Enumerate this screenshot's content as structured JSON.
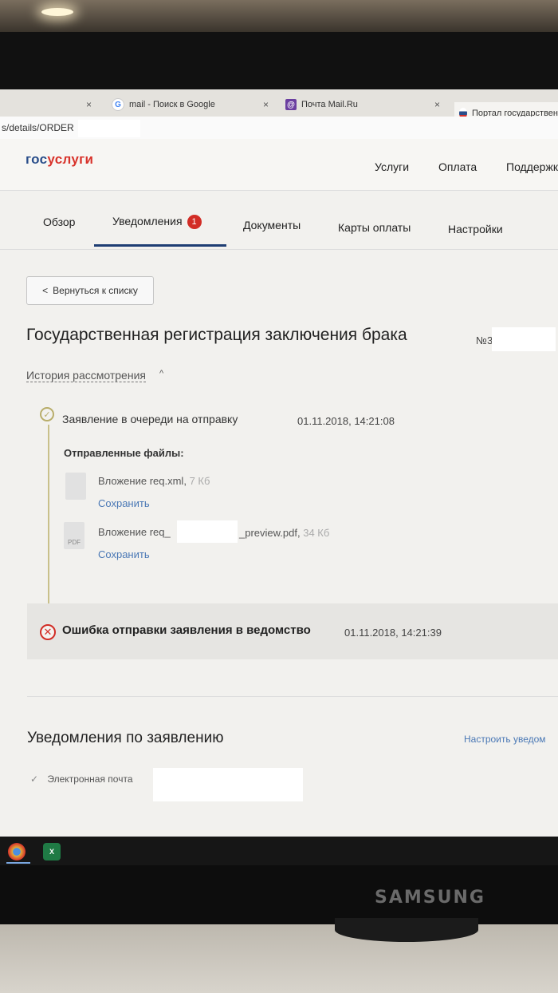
{
  "browser": {
    "tabs": [
      {
        "label": "",
        "favicon": "blank-icon"
      },
      {
        "label": "mail - Поиск в Google",
        "favicon": "google-icon"
      },
      {
        "label": "Почта Mail.Ru",
        "favicon": "mailru-icon"
      },
      {
        "label": "Портал государствен",
        "favicon": "gosuslugi-icon"
      }
    ],
    "close_glyph": "×",
    "address": "s/details/ORDER"
  },
  "header": {
    "logo_part1": "гос",
    "logo_part2": "услуги",
    "nav": [
      "Услуги",
      "Оплата",
      "Поддержк"
    ]
  },
  "subnav": {
    "tabs": [
      "Обзор",
      "Уведомления",
      "Документы",
      "Карты оплаты",
      "Настройки"
    ],
    "badge": "1"
  },
  "main": {
    "back_button": "Вернуться к списку",
    "back_glyph": "<",
    "title": "Государственная регистрация заключения брака",
    "number_prefix": "№3",
    "history_link": "История рассмотрения",
    "history_chevron": "^",
    "event1": {
      "title": "Заявление в очереди на отправку",
      "date": "01.11.2018, 14:21:08",
      "files_header": "Отправленные файлы:",
      "files": [
        {
          "name_start": "Вложение req.xml",
          "name_end": "",
          "size": "7 Кб",
          "icon_label": "",
          "save": "Сохранить"
        },
        {
          "name_start": "Вложение req_",
          "name_end": "_preview.pdf",
          "size": "34 Кб",
          "icon_label": "PDF",
          "save": "Сохранить"
        }
      ]
    },
    "event2": {
      "title": "Ошибка отправки заявления в ведомство",
      "date": "01.11.2018, 14:21:39"
    },
    "notifications_header": "Уведомления по заявлению",
    "notifications_link": "Настроить уведом",
    "email_check": "✓",
    "email_label": "Электронная почта"
  },
  "brand": "SAMSUNG",
  "taskbar": [
    {
      "icon": "chrome-icon",
      "label": ""
    },
    {
      "icon": "excel-icon",
      "label": "X"
    }
  ],
  "colors": {
    "accent": "#2a4e8a",
    "logo_red": "#d8332b",
    "error": "#d22d26",
    "link": "#4a78b5"
  }
}
